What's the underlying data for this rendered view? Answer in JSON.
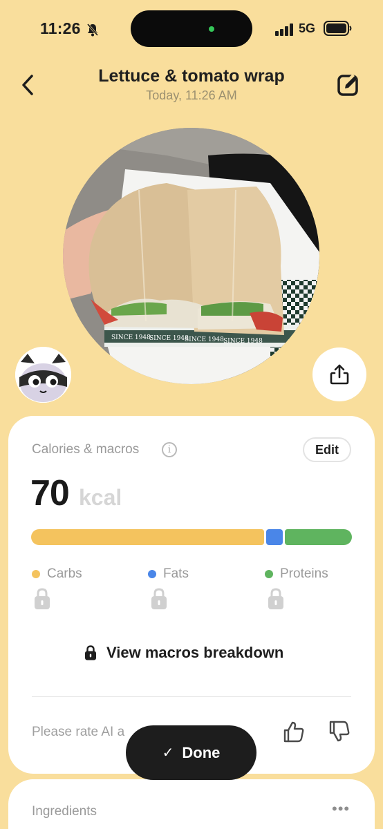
{
  "status_bar": {
    "time": "11:26",
    "network": "5G"
  },
  "header": {
    "title": "Lettuce & tomato wrap",
    "subtitle": "Today, 11:26 AM"
  },
  "photo": {
    "wrapper_print": "SINCE 1948"
  },
  "nutrition_card": {
    "label": "Calories & macros",
    "info_glyph": "i",
    "edit_label": "Edit",
    "calories": {
      "value": "70",
      "unit": "kcal"
    },
    "macro_shares": {
      "carbs": 0.73,
      "fats": 0.05,
      "proteins": 0.22
    },
    "legend": [
      {
        "label": "Carbs",
        "color": "#F4C35E"
      },
      {
        "label": "Fats",
        "color": "#4A86E8"
      },
      {
        "label": "Proteins",
        "color": "#5FB45F"
      }
    ],
    "view_breakdown_label": "View macros breakdown",
    "rate_prompt": "Please rate AI a"
  },
  "done_button": {
    "label": "Done"
  },
  "ingredients_card": {
    "label": "Ingredients",
    "more_glyph": "•••"
  },
  "colors": {
    "background": "#F9DE9C",
    "card": "#FFFFFF",
    "button": "#1D1D1D"
  }
}
